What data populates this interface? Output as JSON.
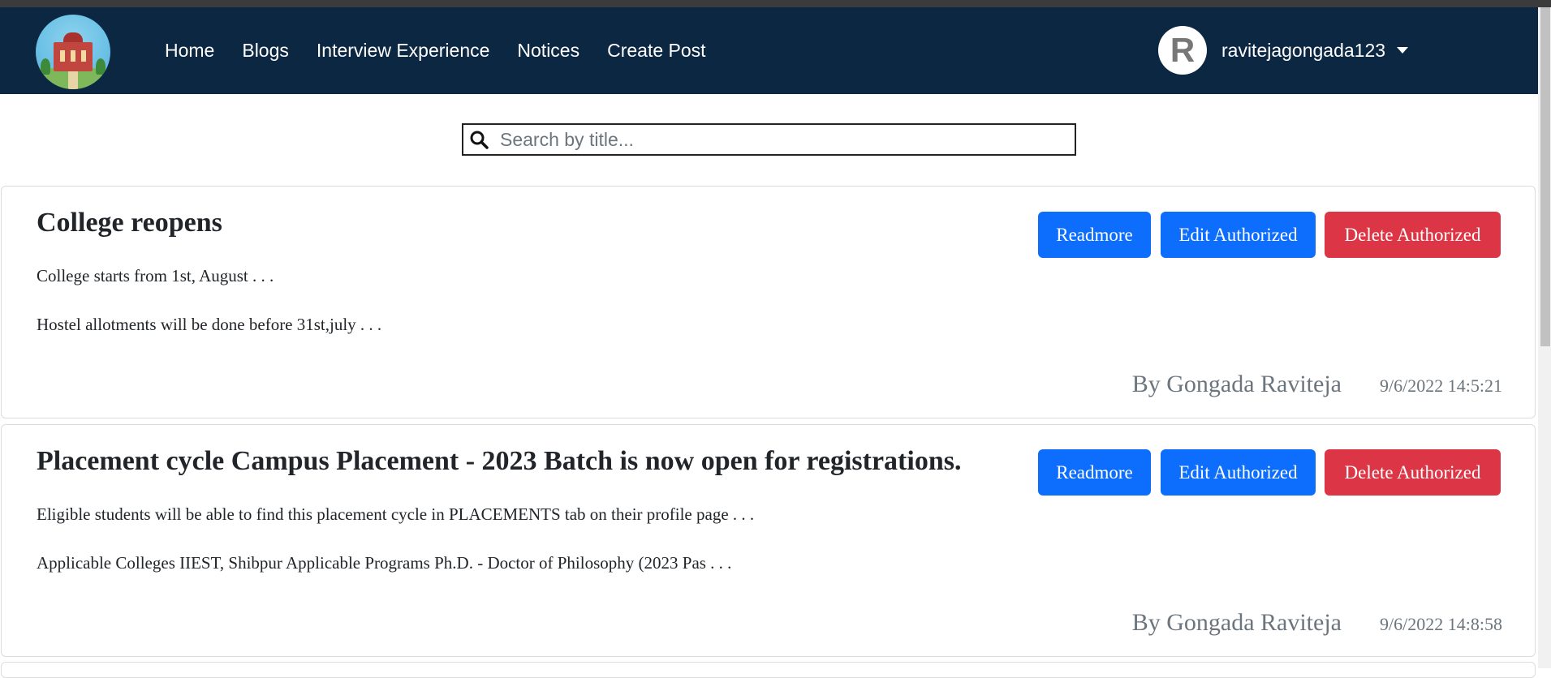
{
  "navbar": {
    "logo_text": "UNIVERSITY",
    "links": [
      "Home",
      "Blogs",
      "Interview Experience",
      "Notices",
      "Create Post"
    ],
    "avatar_letter": "R",
    "username": "ravitejagongada123"
  },
  "search": {
    "placeholder": "Search by title..."
  },
  "posts": [
    {
      "title": "College reopens",
      "line1": "College starts from 1st, August . . .",
      "line2": "Hostel allotments will be done before 31st,july . . .",
      "author": "By Gongada Raviteja",
      "date": "9/6/2022 14:5:21"
    },
    {
      "title": "Placement cycle Campus Placement - 2023 Batch is now open for registrations.",
      "line1": "Eligible students will be able to find this placement cycle in PLACEMENTS tab on their profile page . . .",
      "line2": "Applicable Colleges IIEST, Shibpur Applicable Programs Ph.D. - Doctor of Philosophy (2023 Pas . . .",
      "author": "By Gongada Raviteja",
      "date": "9/6/2022 14:8:58"
    }
  ],
  "buttons": {
    "readmore": "Readmore",
    "edit": "Edit Authorized",
    "delete": "Delete Authorized"
  },
  "colors": {
    "navbar": "#0b2742",
    "primary": "#0d6efd",
    "danger": "#dc3545",
    "muted": "#6c757d"
  }
}
